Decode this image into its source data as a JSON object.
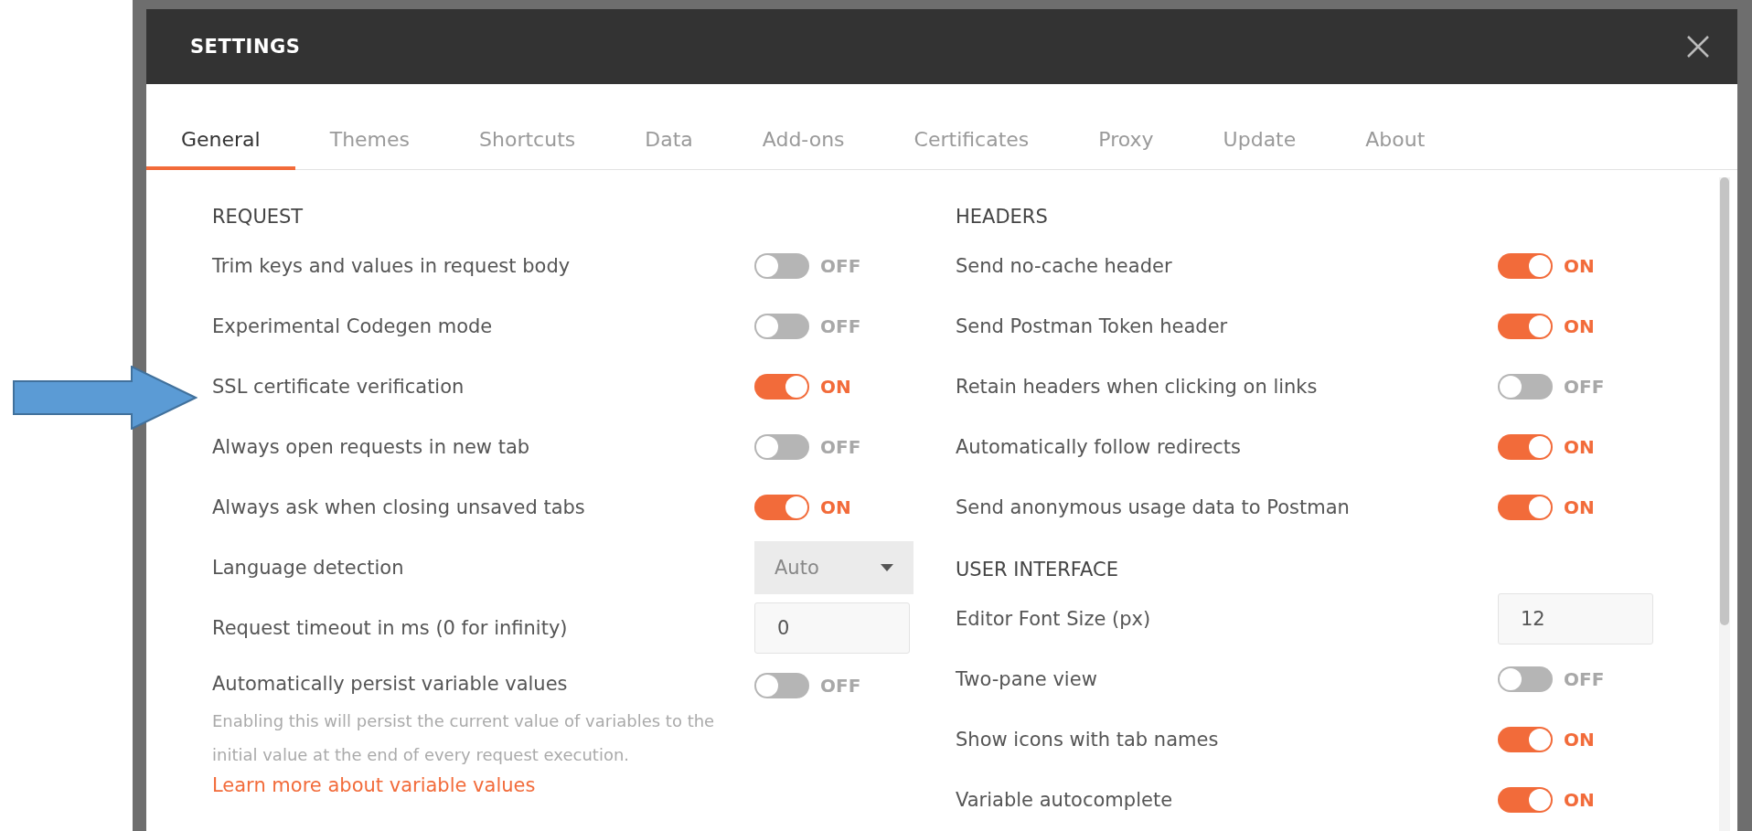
{
  "window": {
    "title": "SETTINGS"
  },
  "tabs": [
    {
      "label": "General",
      "selected": true
    },
    {
      "label": "Themes",
      "selected": false
    },
    {
      "label": "Shortcuts",
      "selected": false
    },
    {
      "label": "Data",
      "selected": false
    },
    {
      "label": "Add-ons",
      "selected": false
    },
    {
      "label": "Certificates",
      "selected": false
    },
    {
      "label": "Proxy",
      "selected": false
    },
    {
      "label": "Update",
      "selected": false
    },
    {
      "label": "About",
      "selected": false
    }
  ],
  "columns": [
    {
      "sections": [
        {
          "heading": "REQUEST",
          "settings": [
            {
              "kind": "toggle",
              "label": "Trim keys and values in request body",
              "on": false,
              "state_text": "OFF"
            },
            {
              "kind": "toggle",
              "label": "Experimental Codegen mode",
              "on": false,
              "state_text": "OFF"
            },
            {
              "kind": "toggle",
              "label": "SSL certificate verification",
              "on": true,
              "state_text": "ON"
            },
            {
              "kind": "toggle",
              "label": "Always open requests in new tab",
              "on": false,
              "state_text": "OFF"
            },
            {
              "kind": "toggle",
              "label": "Always ask when closing unsaved tabs",
              "on": true,
              "state_text": "ON"
            },
            {
              "kind": "dropdown",
              "label": "Language detection",
              "value": "Auto"
            },
            {
              "kind": "input",
              "label": "Request timeout in ms (0 for infinity)",
              "value": "0"
            },
            {
              "kind": "toggle",
              "label": "Automatically persist variable values",
              "on": false,
              "state_text": "OFF",
              "description": "Enabling this will persist the current value of variables to the initial value at the end of every request execution.",
              "link": "Learn more about variable values"
            }
          ]
        }
      ]
    },
    {
      "sections": [
        {
          "heading": "HEADERS",
          "settings": [
            {
              "kind": "toggle",
              "label": "Send no-cache header",
              "on": true,
              "state_text": "ON"
            },
            {
              "kind": "toggle",
              "label": "Send Postman Token header",
              "on": true,
              "state_text": "ON"
            },
            {
              "kind": "toggle",
              "label": "Retain headers when clicking on links",
              "on": false,
              "state_text": "OFF"
            },
            {
              "kind": "toggle",
              "label": "Automatically follow redirects",
              "on": true,
              "state_text": "ON"
            },
            {
              "kind": "toggle",
              "label": "Send anonymous usage data to Postman",
              "on": true,
              "state_text": "ON"
            }
          ]
        },
        {
          "heading": "USER INTERFACE",
          "settings": [
            {
              "kind": "input",
              "label": "Editor Font Size (px)",
              "value": "12"
            },
            {
              "kind": "toggle",
              "label": "Two-pane view",
              "on": false,
              "state_text": "OFF"
            },
            {
              "kind": "toggle",
              "label": "Show icons with tab names",
              "on": true,
              "state_text": "ON"
            },
            {
              "kind": "toggle",
              "label": "Variable autocomplete",
              "on": true,
              "state_text": "ON"
            }
          ]
        }
      ]
    }
  ]
}
